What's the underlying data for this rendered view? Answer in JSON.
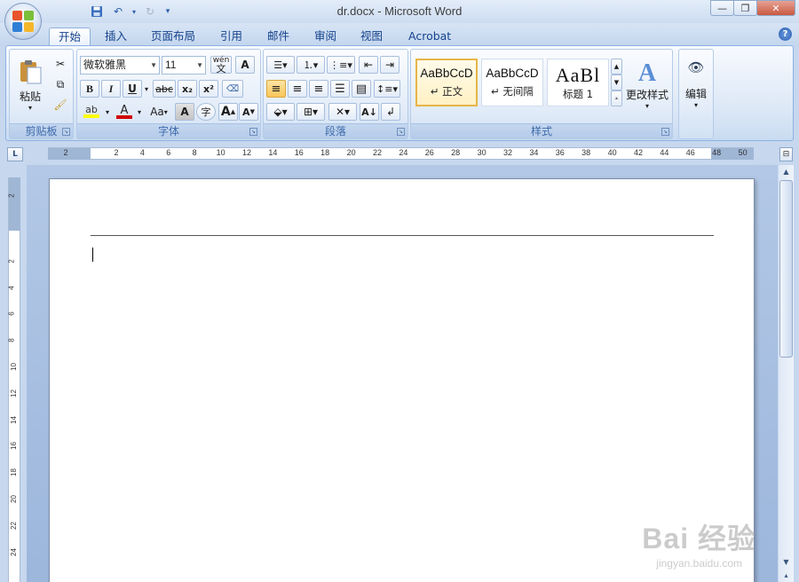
{
  "window": {
    "title": "dr.docx - Microsoft Word"
  },
  "tabs": [
    {
      "label": "开始",
      "active": true
    },
    {
      "label": "插入"
    },
    {
      "label": "页面布局"
    },
    {
      "label": "引用"
    },
    {
      "label": "邮件"
    },
    {
      "label": "审阅"
    },
    {
      "label": "视图"
    },
    {
      "label": "Acrobat"
    }
  ],
  "ribbon": {
    "clipboard": {
      "label": "剪贴板",
      "paste_label": "粘贴"
    },
    "font": {
      "label": "字体",
      "font_name": "微软雅黑",
      "font_size": "11",
      "phonetic_guide": "wén",
      "bold": "B",
      "italic": "I",
      "underline": "U",
      "strike": "abc",
      "subscript": "x₂",
      "superscript": "x²",
      "change_case": "Aa",
      "char_shading": "A",
      "enclose_char": "字",
      "grow": "A",
      "shrink": "A"
    },
    "paragraph": {
      "label": "段落"
    },
    "styles": {
      "label": "样式",
      "items": [
        {
          "sample": "AaBbCcD",
          "name": "↵ 正文"
        },
        {
          "sample": "AaBbCcD",
          "name": "↵ 无间隔"
        },
        {
          "sample": "AaBl",
          "name": "标题 1"
        }
      ],
      "change_styles_label": "更改样式"
    },
    "editing": {
      "label": "编辑"
    }
  },
  "ruler": {
    "horizontal_marks": [
      "2",
      "2",
      "4",
      "6",
      "8",
      "10",
      "12",
      "14",
      "16",
      "18",
      "20",
      "22",
      "24",
      "26",
      "28",
      "30",
      "32",
      "34",
      "36",
      "38",
      "40",
      "42",
      "44",
      "46",
      "48",
      "50"
    ],
    "vertical_marks": [
      "2",
      "2",
      "4",
      "6",
      "8",
      "10",
      "12",
      "14",
      "16",
      "18",
      "20",
      "22",
      "24"
    ]
  },
  "watermark": {
    "line1": "Bai 经验",
    "line2": "jingyan.baidu.com"
  },
  "colors": {
    "highlight": "#ffff00",
    "font_color": "#d00000",
    "accent": "#15428b"
  }
}
